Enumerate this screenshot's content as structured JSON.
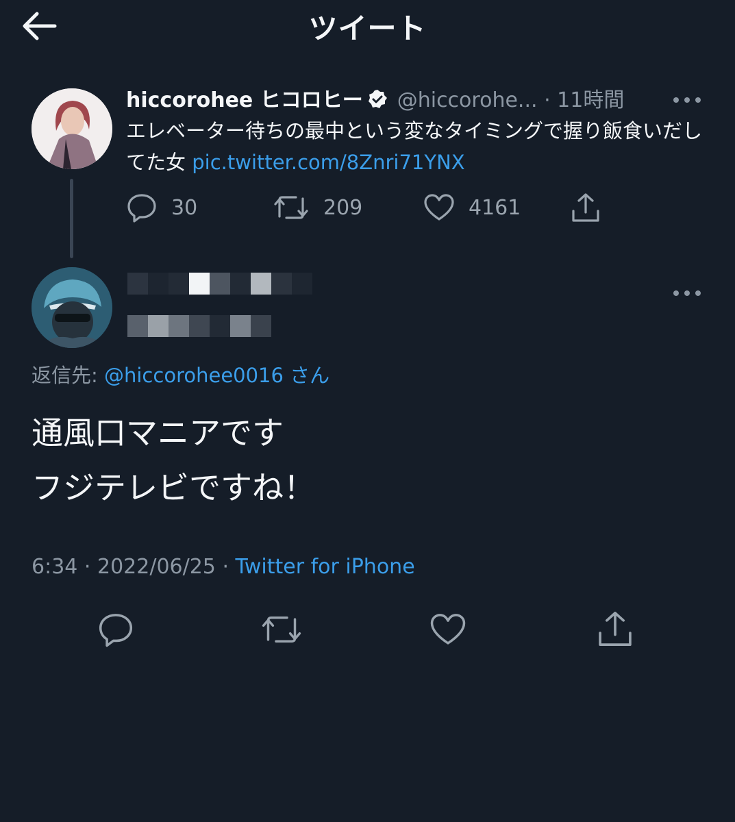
{
  "header": {
    "title": "ツイート",
    "back_icon": "arrow-left-icon"
  },
  "parent_tweet": {
    "display_name": "hiccorohee ヒコロヒー",
    "verified": true,
    "handle": "@hiccorohe...",
    "separator": " · ",
    "time": "11時間",
    "text": "エレベーター待ちの最中という変なタイミングで握り飯食いだしてた女",
    "link": "pic.twitter.com/8Znri71YNX",
    "replies": "30",
    "retweets": "209",
    "likes": "4161"
  },
  "reply_tweet": {
    "reply_to_label": "返信先: ",
    "reply_to_handle": "@hiccorohee0016",
    "reply_to_suffix": " さん",
    "body_line1": "通風口マニアです",
    "body_line2": "フジテレビですね！",
    "time": "6:34",
    "date": "2022/06/25",
    "separator": " · ",
    "source": "Twitter for iPhone"
  },
  "colors": {
    "background": "#151d28",
    "text": "#f4f6f8",
    "secondary": "#8c97a3",
    "accent": "#3b9eea"
  }
}
